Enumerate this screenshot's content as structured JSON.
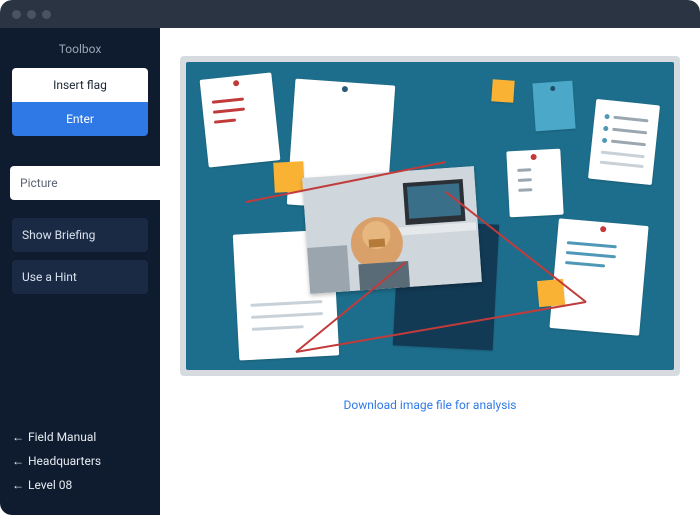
{
  "sidebar": {
    "title": "Toolbox",
    "insert_flag": "Insert flag",
    "enter": "Enter",
    "tab_picture": "Picture",
    "show_briefing": "Show Briefing",
    "use_hint": "Use a Hint",
    "nav": {
      "field_manual": "Field Manual",
      "headquarters": "Headquarters",
      "level": "Level 08"
    }
  },
  "content": {
    "download_label": "Download image file for analysis"
  },
  "colors": {
    "board": "#1d6e8c",
    "accent_blue": "#2f79e6",
    "sidebar_bg": "#0f1b2e",
    "sticky": "#f9b233",
    "red": "#c23b3b"
  }
}
